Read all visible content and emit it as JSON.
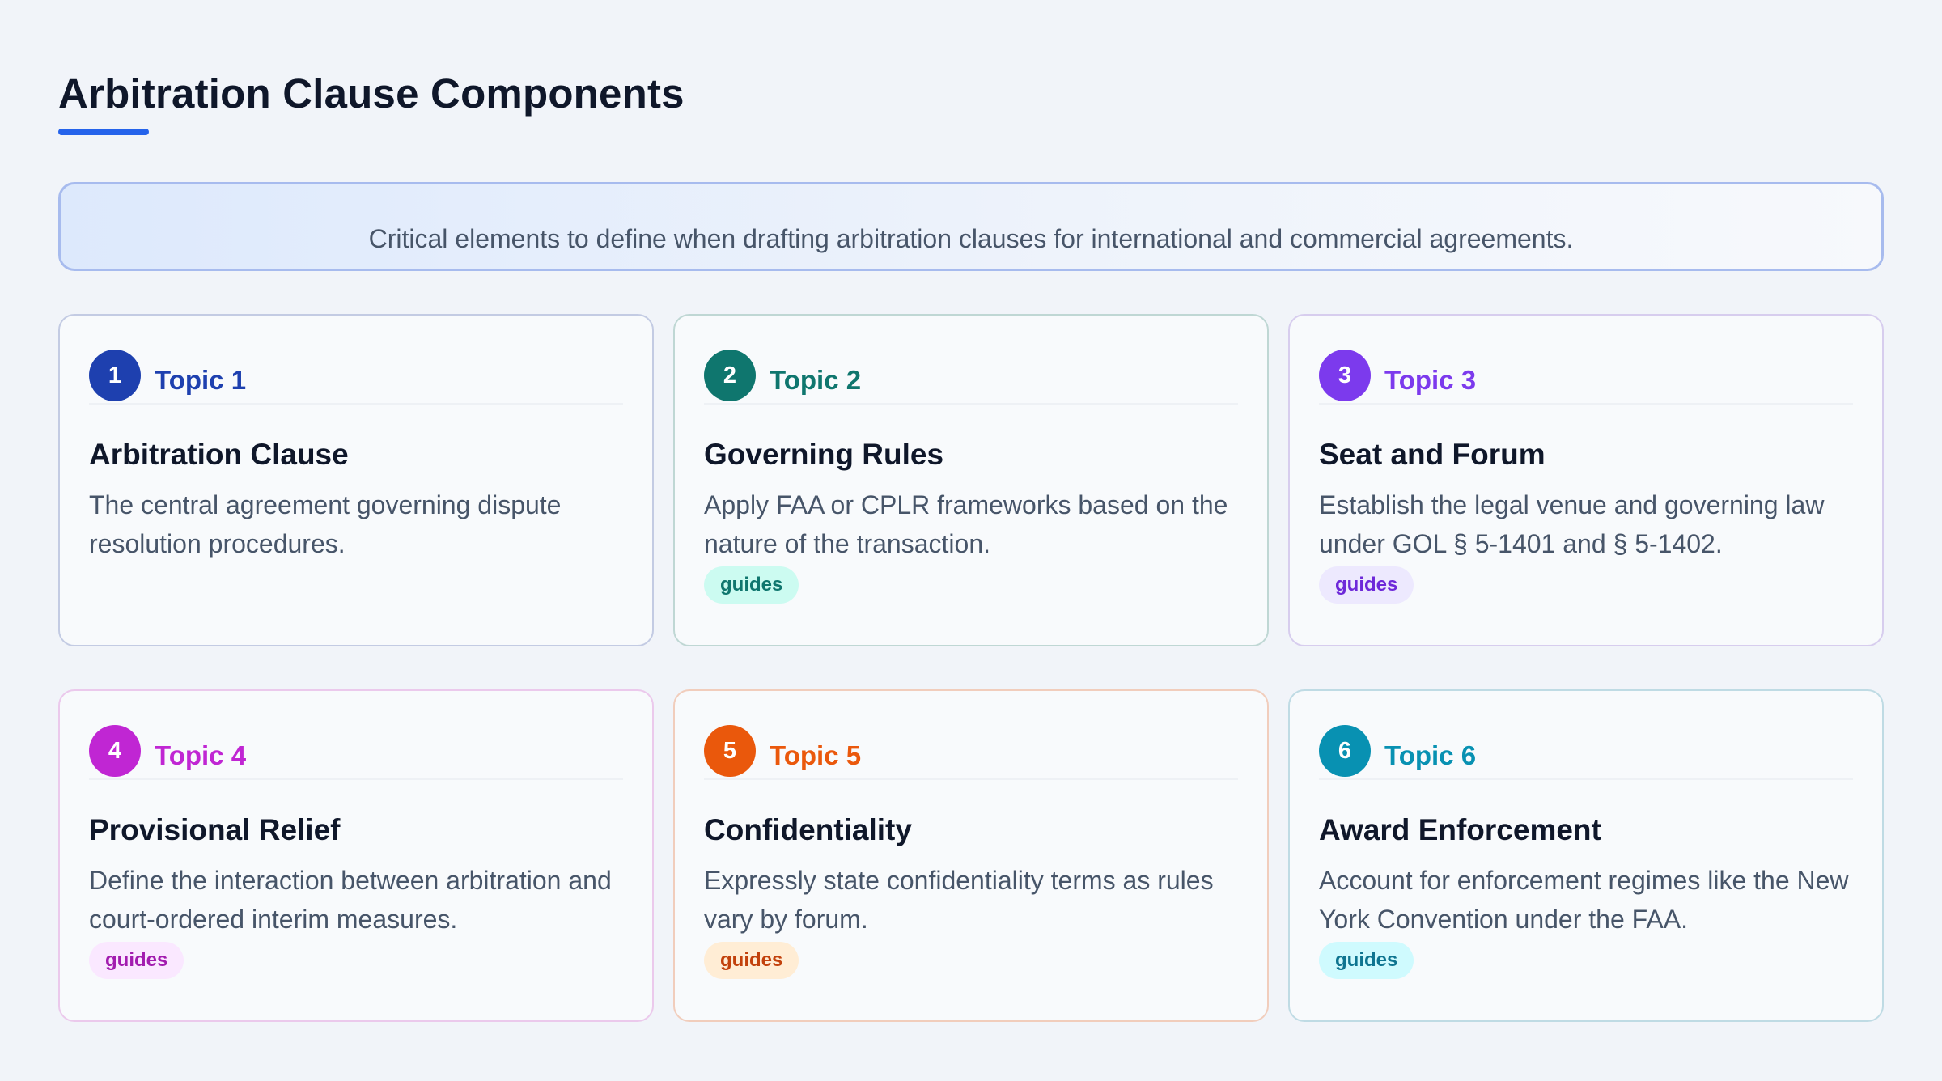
{
  "page": {
    "title": "Arbitration Clause Components",
    "accent": "#2563eb",
    "intro": "Critical elements to define when drafting arbitration clauses for international and commercial agreements."
  },
  "cards": [
    {
      "number": "1",
      "topic": "Topic 1",
      "title": "Arbitration Clause",
      "description": "The central agreement governing dispute resolution procedures.",
      "tag": "",
      "color": "#1e40af",
      "tag_bg": "",
      "tag_color": ""
    },
    {
      "number": "2",
      "topic": "Topic 2",
      "title": "Governing Rules",
      "description": "Apply FAA or CPLR frameworks based on the nature of the transaction.",
      "tag": "guides",
      "color": "#0f766e",
      "tag_bg": "#ccfbf1",
      "tag_color": "#0f766e"
    },
    {
      "number": "3",
      "topic": "Topic 3",
      "title": "Seat and Forum",
      "description": "Establish the legal venue and governing law under GOL § 5-1401 and § 5-1402.",
      "tag": "guides",
      "color": "#7c3aed",
      "tag_bg": "#ede9fe",
      "tag_color": "#6d28d9"
    },
    {
      "number": "4",
      "topic": "Topic 4",
      "title": "Provisional Relief",
      "description": "Define the interaction between arbitration and court-ordered interim measures.",
      "tag": "guides",
      "color": "#c026d3",
      "tag_bg": "#fae8ff",
      "tag_color": "#a21caf"
    },
    {
      "number": "5",
      "topic": "Topic 5",
      "title": "Confidentiality",
      "description": "Expressly state confidentiality terms as rules vary by forum.",
      "tag": "guides",
      "color": "#ea580c",
      "tag_bg": "#ffedd5",
      "tag_color": "#c2410c"
    },
    {
      "number": "6",
      "topic": "Topic 6",
      "title": "Award Enforcement",
      "description": "Account for enforcement regimes like the New York Convention under the FAA.",
      "tag": "guides",
      "color": "#0891b2",
      "tag_bg": "#cffafe",
      "tag_color": "#0e7490"
    }
  ]
}
